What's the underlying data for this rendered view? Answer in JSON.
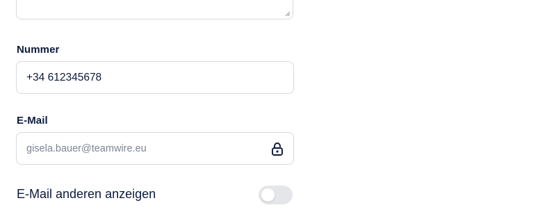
{
  "form": {
    "notes_field": {
      "value": ""
    },
    "number_field": {
      "label": "Nummer",
      "value": "+34 612345678"
    },
    "email_field": {
      "label": "E-Mail",
      "value": "gisela.bauer@teamwire.eu",
      "locked": true,
      "icon": "lock-icon"
    },
    "show_email_toggle": {
      "label": "E-Mail anderen anzeigen",
      "enabled": false
    }
  },
  "colors": {
    "text": "#0c1a3a",
    "muted_text": "#7d8594",
    "border": "#d6d9df",
    "toggle_off": "#e4e6ea"
  }
}
